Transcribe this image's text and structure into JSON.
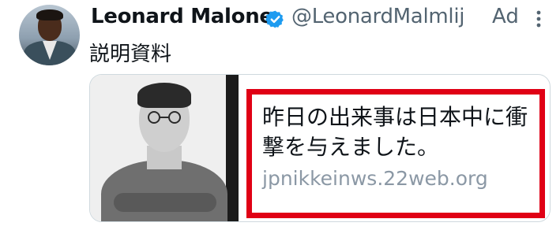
{
  "tweet": {
    "author_name": "Leonard Malone",
    "handle": "@LeonardMalmlij",
    "ad_label": "Ad",
    "text": "説明資料",
    "verified": true
  },
  "card": {
    "headline": "昨日の出来事は日本中に衝撃を与えました。",
    "domain": "jpnikkeinws.22web.org"
  },
  "colors": {
    "verified_badge": "#1d9bf0",
    "highlight_box": "#e00015",
    "secondary_text": "#536471",
    "domain_text": "#8b98a5"
  },
  "icons": {
    "verified": "verified-badge-icon",
    "more": "more-options-icon"
  }
}
